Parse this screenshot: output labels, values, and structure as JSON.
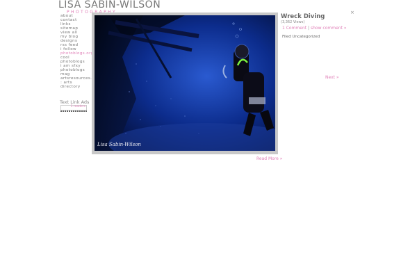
{
  "logo": {
    "name": "LISA SABIN-WILSON",
    "subtitle": "PHOTOGRAPHY"
  },
  "sidebar": {
    "items": [
      {
        "label": "about",
        "pink": false
      },
      {
        "label": "contact",
        "pink": false
      },
      {
        "label": "links",
        "pink": false
      },
      {
        "label": "sitemap",
        "pink": false
      },
      {
        "label": "view all",
        "pink": false
      },
      {
        "label": "my blog",
        "pink": false
      },
      {
        "label": "designs",
        "pink": false
      },
      {
        "label": "rss feed",
        "pink": false
      },
      {
        "label": "i follow",
        "pink": false
      },
      {
        "label": "photoblogs.org",
        "pink": true
      },
      {
        "label": "cool",
        "pink": false
      },
      {
        "label": "photoblogs",
        "pink": false
      },
      {
        "label": "i am sfxy",
        "pink": false
      },
      {
        "label": "photoblogs",
        "pink": false
      },
      {
        "label": "mag",
        "pink": false
      },
      {
        "label": "artsresources.net",
        "pink": false
      },
      {
        "label": ": arts",
        "pink": false
      },
      {
        "label": "directory",
        "pink": false
      }
    ],
    "text_link_ads": "Text Link Ads",
    "widget_label": "1 readers"
  },
  "photo": {
    "watermark": "Lisa Sabin-Wilson",
    "colors": {
      "deep": "#04103a",
      "mid": "#0a2a8a",
      "light": "#3a6ad0"
    }
  },
  "post": {
    "title": "Wreck Diving",
    "views": "(3,362 Views)",
    "comments": "1 Comment",
    "comment_sep": "|",
    "show_comment": "show comment »",
    "filed": "Filed Uncategorized",
    "next": "Next »",
    "read_more": "Read More »",
    "close": "×"
  },
  "colors": {
    "accent_pink": "#e080b8",
    "text_gray": "#777777"
  }
}
